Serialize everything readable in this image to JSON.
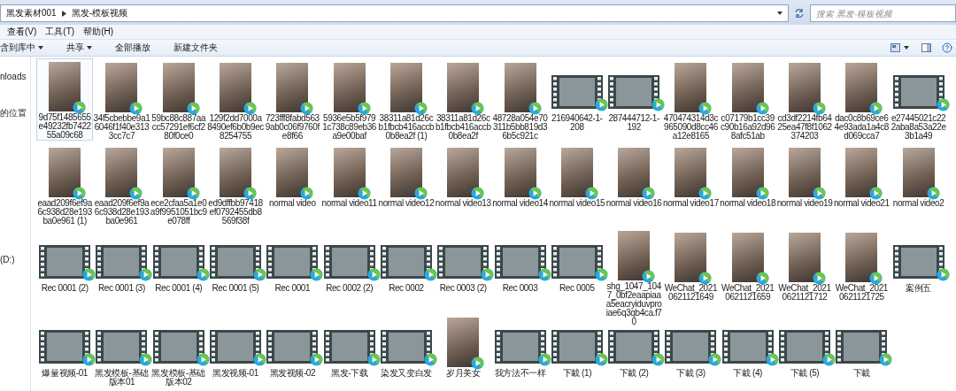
{
  "address_bar": {
    "path": [
      {
        "label": "黑发素材001"
      },
      {
        "label": "黑发-模板视频"
      }
    ]
  },
  "search": {
    "placeholder": "搜索 黑发-模板视频"
  },
  "menu": [
    "查看(V)",
    "工具(T)",
    "帮助(H)"
  ],
  "toolbar": [
    {
      "label": "含到库中",
      "kind": "dropdown"
    },
    {
      "label": "共享",
      "kind": "dropdown"
    },
    {
      "label": "全部播放",
      "kind": "button"
    },
    {
      "label": "新建文件夹",
      "kind": "button"
    }
  ],
  "sidebar": {
    "items": [
      "nloads",
      "的位置",
      "(D:)"
    ]
  },
  "files": [
    {
      "name": "9d75f1485655e49232fb742255a09c68",
      "kind": "portrait",
      "selected": true
    },
    {
      "name": "34f5cbebbe9a16046f1f40e3133cc7c7",
      "kind": "portrait",
      "selected": false
    },
    {
      "name": "59bc88c887aacc57291ef6cf280f0ce0",
      "kind": "portrait",
      "selected": false
    },
    {
      "name": "129f2dd7000a8490ef6b0b9ec8254755",
      "kind": "portrait",
      "selected": false
    },
    {
      "name": "723fff8fabd5639ab0c06f9760fe8f66",
      "kind": "portrait",
      "selected": false
    },
    {
      "name": "5936e5b5f9791c738c89eb36a9e00baf",
      "kind": "portrait",
      "selected": false
    },
    {
      "name": "38311a81d26cb1fbcb416accb0b8ea2f (1)",
      "kind": "portrait",
      "selected": false
    },
    {
      "name": "38311a81d26cb1fbcb416accb0b8ea2f",
      "kind": "portrait",
      "selected": false
    },
    {
      "name": "48728a054e70311b5bb819d36b5c921c",
      "kind": "portrait",
      "selected": false
    },
    {
      "name": "216940642-1-208",
      "kind": "film",
      "selected": false
    },
    {
      "name": "287444712-1-192",
      "kind": "film",
      "selected": false
    },
    {
      "name": "470474314d3c965090d8cc46a12e8165",
      "kind": "portrait",
      "selected": false
    },
    {
      "name": "c07179b1cc39c90b16a92d968afc51ab",
      "kind": "portrait",
      "selected": false
    },
    {
      "name": "cd3df2214fb6425ea47f8f1062374203",
      "kind": "portrait",
      "selected": false
    },
    {
      "name": "dac0c8b69ce64e93ada1a4c8d069cca7",
      "kind": "portrait",
      "selected": false
    },
    {
      "name": "e27445021c222aba8a53a22e3b1a49",
      "kind": "film",
      "selected": false
    },
    {
      "name": "eaad209f6ef9a6c938d28e193ba0e961 (1)",
      "kind": "portrait",
      "selected": false
    },
    {
      "name": "eaad209f6ef9a6c938d28e193ba0e961",
      "kind": "portrait",
      "selected": false
    },
    {
      "name": "ece2cfaa5a1e0a9f9951051bc9e078ff",
      "kind": "portrait",
      "selected": false
    },
    {
      "name": "ed9dffbb97418ef0792455db8569f38f",
      "kind": "portrait",
      "selected": false
    },
    {
      "name": "normal video",
      "kind": "portrait",
      "selected": false
    },
    {
      "name": "normal video11",
      "kind": "portrait",
      "selected": false
    },
    {
      "name": "normal video12",
      "kind": "portrait",
      "selected": false
    },
    {
      "name": "normal video13",
      "kind": "portrait",
      "selected": false
    },
    {
      "name": "normal video14",
      "kind": "portrait",
      "selected": false
    },
    {
      "name": "normal video15",
      "kind": "portrait",
      "selected": false
    },
    {
      "name": "normal video16",
      "kind": "portrait",
      "selected": false
    },
    {
      "name": "normal video17",
      "kind": "portrait",
      "selected": false
    },
    {
      "name": "normal video18",
      "kind": "portrait",
      "selected": false
    },
    {
      "name": "normal video19",
      "kind": "portrait",
      "selected": false
    },
    {
      "name": "normal video21",
      "kind": "portrait",
      "selected": false
    },
    {
      "name": "normal video2",
      "kind": "portrait",
      "selected": false
    },
    {
      "name": "Rec 0001 (2)",
      "kind": "film",
      "selected": false
    },
    {
      "name": "Rec 0001 (3)",
      "kind": "film",
      "selected": false
    },
    {
      "name": "Rec 0001 (4)",
      "kind": "film",
      "selected": false
    },
    {
      "name": "Rec 0001 (5)",
      "kind": "film",
      "selected": false
    },
    {
      "name": "Rec 0001",
      "kind": "film",
      "selected": false
    },
    {
      "name": "Rec 0002 (2)",
      "kind": "film",
      "selected": false
    },
    {
      "name": "Rec 0002",
      "kind": "film",
      "selected": false
    },
    {
      "name": "Rec 0003 (2)",
      "kind": "film",
      "selected": false
    },
    {
      "name": "Rec 0003",
      "kind": "film",
      "selected": false
    },
    {
      "name": "Rec 0005",
      "kind": "film",
      "selected": false
    },
    {
      "name": "shg_1047_1047_0bf2eaapiaaa5eacryiduvproiae6q3qb4ca.f70",
      "kind": "portrait",
      "selected": false
    },
    {
      "name": "WeChat_20210621121649",
      "kind": "portrait",
      "selected": false
    },
    {
      "name": "WeChat_20210621121659",
      "kind": "portrait",
      "selected": false
    },
    {
      "name": "WeChat_20210621121712",
      "kind": "portrait",
      "selected": false
    },
    {
      "name": "WeChat_20210621121725",
      "kind": "portrait",
      "selected": false
    },
    {
      "name": "案例五",
      "kind": "film",
      "selected": false
    },
    {
      "name": "爆量视频-01",
      "kind": "film",
      "selected": false
    },
    {
      "name": "黑发模板-基础版本01",
      "kind": "film",
      "selected": false
    },
    {
      "name": "黑发模板-基础版本02",
      "kind": "film",
      "selected": false
    },
    {
      "name": "黑发视频-01",
      "kind": "film",
      "selected": false
    },
    {
      "name": "黑发视频-02",
      "kind": "film",
      "selected": false
    },
    {
      "name": "黑发-下载",
      "kind": "film",
      "selected": false
    },
    {
      "name": "染发又变白发",
      "kind": "film",
      "selected": false
    },
    {
      "name": "岁月美女",
      "kind": "portrait",
      "selected": false
    },
    {
      "name": "我方法不一样",
      "kind": "film",
      "selected": false
    },
    {
      "name": "下載 (1)",
      "kind": "film",
      "selected": false
    },
    {
      "name": "下載 (2)",
      "kind": "film",
      "selected": false
    },
    {
      "name": "下載 (3)",
      "kind": "film",
      "selected": false
    },
    {
      "name": "下載 (4)",
      "kind": "film",
      "selected": false
    },
    {
      "name": "下載 (5)",
      "kind": "film",
      "selected": false
    },
    {
      "name": "下載",
      "kind": "film",
      "selected": false
    }
  ]
}
